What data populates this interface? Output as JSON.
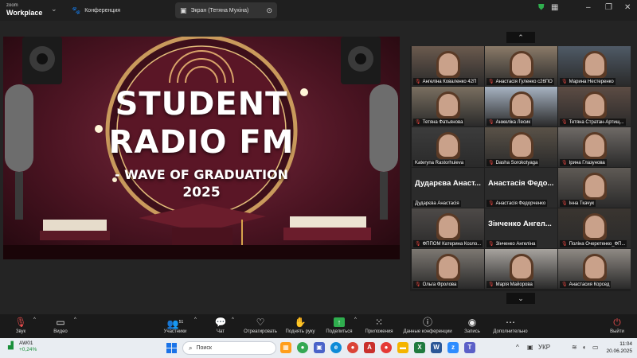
{
  "app": {
    "brand_line1": "zoom",
    "brand_line2": "Workplace"
  },
  "tabs": [
    {
      "label": "Конференция",
      "icon": "paw-icon"
    },
    {
      "label": "Экран (Тетяна Мухіна)",
      "icon": "screen-share-icon"
    }
  ],
  "shared_content": {
    "title_line1": "STUDENT",
    "title_line2": "RADIO FM",
    "title_line3": "- WAVE OF GRADUATION",
    "title_line4": "2025"
  },
  "gallery": {
    "participants": [
      {
        "label": "Ангеліна Коваленко 42П",
        "video": true,
        "muted": true
      },
      {
        "label": "Анастасія Гуленко с26ПО",
        "video": true,
        "muted": true
      },
      {
        "label": "Марина Нестеренко",
        "video": true,
        "muted": true
      },
      {
        "label": "Тетяна Фатьянова",
        "video": true,
        "muted": true
      },
      {
        "label": "Анжеліка Лесик",
        "video": true,
        "muted": true
      },
      {
        "label": "Тетяна Стратан-Артищ...",
        "video": true,
        "muted": true
      },
      {
        "label": "Kateryna Rastorhuieva",
        "video": true,
        "muted": false
      },
      {
        "label": "Dasha Sorokotyaga",
        "video": true,
        "muted": true
      },
      {
        "label": "Ірина Глазунова",
        "video": true,
        "muted": true
      },
      {
        "label": "Дударєва Анастасія",
        "name_big": "Дударєва Анаст...",
        "video": false,
        "muted": false
      },
      {
        "label": "Анастасія Федорченко",
        "name_big": "Анастасія Федо...",
        "video": false,
        "muted": true
      },
      {
        "label": "Інна Ткачук",
        "video": true,
        "muted": true
      },
      {
        "label": "ФППОМ Катерина Козло...",
        "video": true,
        "muted": true
      },
      {
        "label": "Зінченко Ангеліна",
        "name_big": "Зінченко Ангел...",
        "video": false,
        "muted": true
      },
      {
        "label": "Поліна Очеретенко_ФП...",
        "video": true,
        "muted": true
      },
      {
        "label": "Ольга Фролова",
        "video": true,
        "muted": true
      },
      {
        "label": "Марія Майорова",
        "video": true,
        "muted": true
      },
      {
        "label": "Анастасия Корсед",
        "video": true,
        "muted": true
      }
    ]
  },
  "toolbar": {
    "audio": "Звук",
    "video": "Видео",
    "participants": "Участники",
    "participants_count": "51",
    "chat": "Чат",
    "react": "Отреагировать",
    "raise_hand": "Поднять руку",
    "share": "Поделиться",
    "apps": "Приложения",
    "meeting_info": "Данные конференции",
    "record": "Запись",
    "more": "Дополнительно",
    "leave": "Выйти"
  },
  "taskbar": {
    "stock_name": "AW01",
    "stock_change": "+0,24%",
    "search_placeholder": "Поиск",
    "lang": "УКР",
    "time": "11:04",
    "date": "20.06.2025"
  },
  "colors": {
    "accent_green": "#2fae4e",
    "leave_red": "#e64b4b",
    "mute_red": "#e0443e"
  }
}
